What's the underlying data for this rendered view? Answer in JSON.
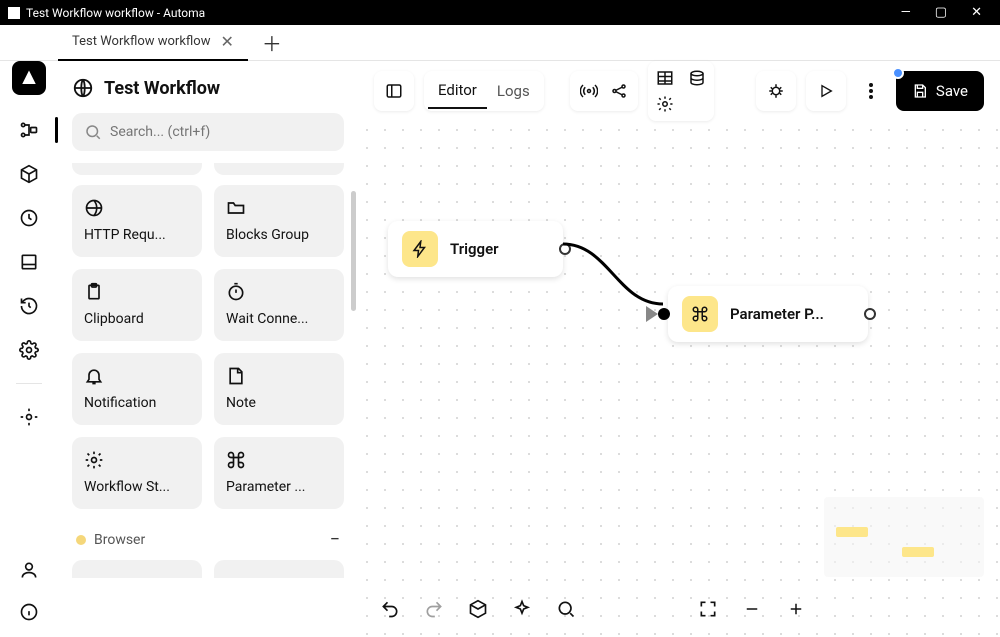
{
  "window": {
    "title": "Test Workflow workflow - Automa"
  },
  "tab": {
    "label": "Test Workflow workflow"
  },
  "workflow": {
    "name": "Test Workflow"
  },
  "search": {
    "placeholder": "Search... (ctrl+f)"
  },
  "blocks": [
    {
      "label": "HTTP Requ...",
      "icon": "globe"
    },
    {
      "label": "Blocks Group",
      "icon": "folder"
    },
    {
      "label": "Clipboard",
      "icon": "clipboard"
    },
    {
      "label": "Wait Conne...",
      "icon": "timer"
    },
    {
      "label": "Notification",
      "icon": "bell"
    },
    {
      "label": "Note",
      "icon": "note"
    },
    {
      "label": "Workflow St...",
      "icon": "gear"
    },
    {
      "label": "Parameter ...",
      "icon": "command"
    }
  ],
  "category": {
    "name": "Browser"
  },
  "topbar": {
    "tabs": {
      "editor": "Editor",
      "logs": "Logs"
    },
    "save": "Save"
  },
  "nodes": {
    "trigger": {
      "label": "Trigger"
    },
    "parameter": {
      "label": "Parameter P..."
    }
  }
}
